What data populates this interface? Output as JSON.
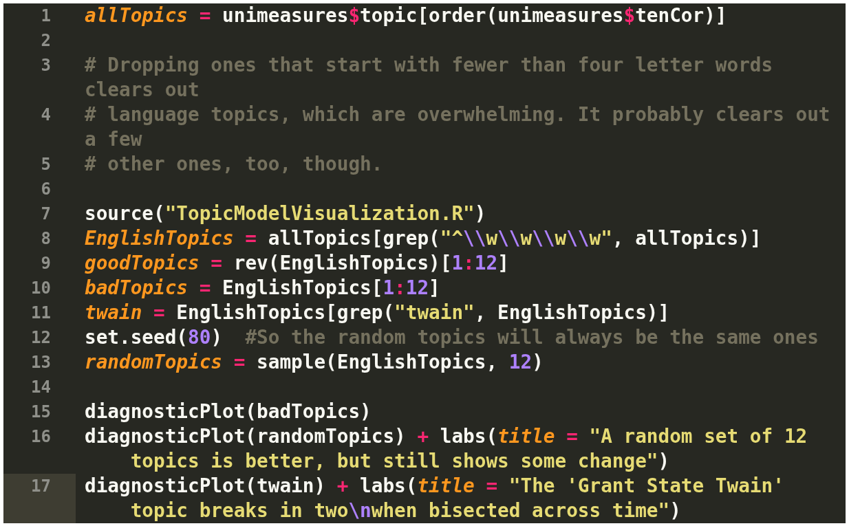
{
  "editor": {
    "lines": [
      {
        "number": "1",
        "current": false,
        "rows": [
          {
            "tokens": [
              {
                "kind": "var",
                "text": "allTopics"
              },
              {
                "kind": "op",
                "text": " ="
              },
              {
                "kind": "plain",
                "text": " unimeasures"
              },
              {
                "kind": "op",
                "text": "$"
              },
              {
                "kind": "plain",
                "text": "topic[order(unimeasures"
              },
              {
                "kind": "op",
                "text": "$"
              },
              {
                "kind": "plain",
                "text": "tenCor)]"
              }
            ]
          }
        ]
      },
      {
        "number": "2",
        "current": false
      },
      {
        "number": "3",
        "current": false,
        "rows": [
          {
            "tokens": [
              {
                "kind": "comment",
                "text": "# Dropping ones that start with fewer than four letter words"
              }
            ]
          },
          {
            "tokens": [
              {
                "kind": "comment",
                "text": "clears out"
              }
            ]
          }
        ]
      },
      {
        "number": "4",
        "current": false,
        "rows": [
          {
            "tokens": [
              {
                "kind": "comment",
                "text": "# language topics, which are overwhelming. It probably clears out"
              }
            ]
          },
          {
            "tokens": [
              {
                "kind": "comment",
                "text": "a few"
              }
            ]
          }
        ]
      },
      {
        "number": "5",
        "current": false,
        "rows": [
          {
            "tokens": [
              {
                "kind": "comment",
                "text": "# other ones, too, though."
              }
            ]
          }
        ]
      },
      {
        "number": "6",
        "current": false
      },
      {
        "number": "7",
        "current": false,
        "rows": [
          {
            "tokens": [
              {
                "kind": "plain",
                "text": "source("
              },
              {
                "kind": "string",
                "text": "\"TopicModelVisualization.R\""
              },
              {
                "kind": "plain",
                "text": ")"
              }
            ]
          }
        ]
      },
      {
        "number": "8",
        "current": false,
        "rows": [
          {
            "tokens": [
              {
                "kind": "var",
                "text": "EnglishTopics"
              },
              {
                "kind": "op",
                "text": " ="
              },
              {
                "kind": "plain",
                "text": " allTopics[grep("
              },
              {
                "kind": "string",
                "text": "\"^"
              },
              {
                "kind": "escape",
                "text": "\\\\"
              },
              {
                "kind": "string",
                "text": "w"
              },
              {
                "kind": "escape",
                "text": "\\\\"
              },
              {
                "kind": "string",
                "text": "w"
              },
              {
                "kind": "escape",
                "text": "\\\\"
              },
              {
                "kind": "string",
                "text": "w"
              },
              {
                "kind": "escape",
                "text": "\\\\"
              },
              {
                "kind": "string",
                "text": "w\""
              },
              {
                "kind": "plain",
                "text": ", allTopics)]"
              }
            ]
          }
        ]
      },
      {
        "number": "9",
        "current": false,
        "rows": [
          {
            "tokens": [
              {
                "kind": "var",
                "text": "goodTopics"
              },
              {
                "kind": "op",
                "text": " ="
              },
              {
                "kind": "plain",
                "text": " rev(EnglishTopics)["
              },
              {
                "kind": "number",
                "text": "1"
              },
              {
                "kind": "op",
                "text": ":"
              },
              {
                "kind": "number",
                "text": "12"
              },
              {
                "kind": "plain",
                "text": "]"
              }
            ]
          }
        ]
      },
      {
        "number": "10",
        "current": false,
        "rows": [
          {
            "tokens": [
              {
                "kind": "var",
                "text": "badTopics"
              },
              {
                "kind": "op",
                "text": " ="
              },
              {
                "kind": "plain",
                "text": " EnglishTopics["
              },
              {
                "kind": "number",
                "text": "1"
              },
              {
                "kind": "op",
                "text": ":"
              },
              {
                "kind": "number",
                "text": "12"
              },
              {
                "kind": "plain",
                "text": "]"
              }
            ]
          }
        ]
      },
      {
        "number": "11",
        "current": false,
        "rows": [
          {
            "tokens": [
              {
                "kind": "var",
                "text": "twain"
              },
              {
                "kind": "op",
                "text": " ="
              },
              {
                "kind": "plain",
                "text": " EnglishTopics[grep("
              },
              {
                "kind": "string",
                "text": "\"twain\""
              },
              {
                "kind": "plain",
                "text": ", EnglishTopics)]"
              }
            ]
          }
        ]
      },
      {
        "number": "12",
        "current": false,
        "rows": [
          {
            "tokens": [
              {
                "kind": "plain",
                "text": "set.seed("
              },
              {
                "kind": "number",
                "text": "80"
              },
              {
                "kind": "plain",
                "text": ")  "
              },
              {
                "kind": "comment",
                "text": "#So the random topics will always be the same ones"
              }
            ]
          }
        ]
      },
      {
        "number": "13",
        "current": false,
        "rows": [
          {
            "tokens": [
              {
                "kind": "var",
                "text": "randomTopics"
              },
              {
                "kind": "op",
                "text": " ="
              },
              {
                "kind": "plain",
                "text": " sample(EnglishTopics, "
              },
              {
                "kind": "number",
                "text": "12"
              },
              {
                "kind": "plain",
                "text": ")"
              }
            ]
          }
        ]
      },
      {
        "number": "14",
        "current": false
      },
      {
        "number": "15",
        "current": false,
        "rows": [
          {
            "tokens": [
              {
                "kind": "plain",
                "text": "diagnosticPlot(badTopics)"
              }
            ]
          }
        ]
      },
      {
        "number": "16",
        "current": false,
        "rows": [
          {
            "tokens": [
              {
                "kind": "plain",
                "text": "diagnosticPlot(randomTopics) "
              },
              {
                "kind": "op",
                "text": "+"
              },
              {
                "kind": "plain",
                "text": " labs("
              },
              {
                "kind": "var",
                "text": "title"
              },
              {
                "kind": "op",
                "text": " ="
              },
              {
                "kind": "string",
                "text": " \"A random set of 12"
              }
            ]
          },
          {
            "tokens": [
              {
                "kind": "string",
                "text": "    topics is better, but still shows some change\""
              },
              {
                "kind": "plain",
                "text": ")"
              }
            ]
          }
        ]
      },
      {
        "number": "17",
        "current": true,
        "rows": [
          {
            "tokens": [
              {
                "kind": "plain",
                "text": "diagnosticPlot(twain) "
              },
              {
                "kind": "op",
                "text": "+"
              },
              {
                "kind": "plain",
                "text": " labs("
              },
              {
                "kind": "var",
                "text": "title"
              },
              {
                "kind": "op",
                "text": " ="
              },
              {
                "kind": "string",
                "text": " \"The 'Grant State Twain'"
              }
            ]
          },
          {
            "tokens": [
              {
                "kind": "string",
                "text": "    topic breaks in two"
              },
              {
                "kind": "escape",
                "text": "\\n"
              },
              {
                "kind": "string",
                "text": "when bisected across time\""
              },
              {
                "kind": "plain",
                "text": ")"
              }
            ]
          }
        ]
      }
    ]
  }
}
